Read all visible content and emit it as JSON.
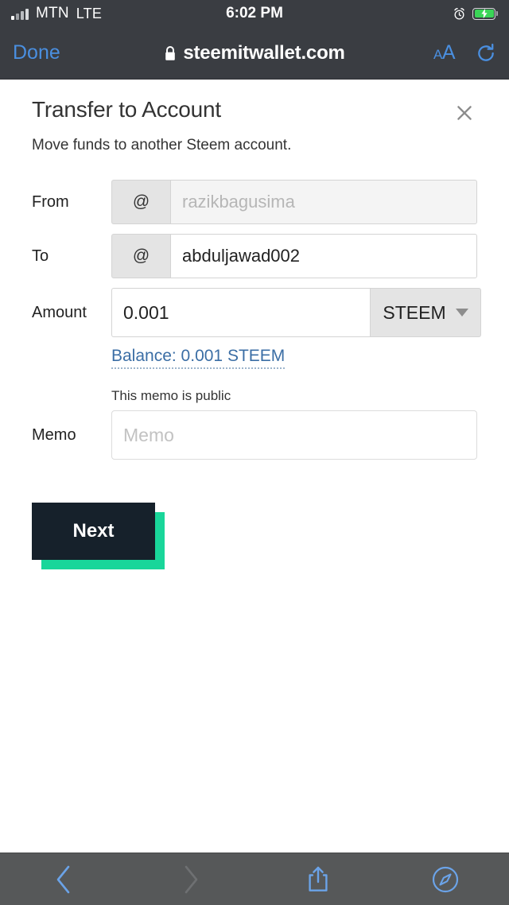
{
  "status_bar": {
    "carrier": "MTN",
    "network": "LTE",
    "time": "6:02 PM",
    "alarm_icon": "alarm-clock-icon",
    "battery_icon": "battery-charging-icon",
    "signal_icon": "signal-bars-icon"
  },
  "browser": {
    "done_label": "Done",
    "lock_icon": "lock-icon",
    "url": "steemitwallet.com",
    "text_size_small": "A",
    "text_size_large": "A",
    "reload_icon": "reload-icon",
    "toolbar": {
      "back_icon": "chevron-left-icon",
      "forward_icon": "chevron-right-icon",
      "share_icon": "share-icon",
      "tabs_icon": "compass-icon"
    }
  },
  "page": {
    "title": "Transfer to Account",
    "subtitle": "Move funds to another Steem account.",
    "close_icon": "close-icon"
  },
  "form": {
    "from": {
      "label": "From",
      "addon": "@",
      "value": "",
      "placeholder": "razikbagusima",
      "disabled": true
    },
    "to": {
      "label": "To",
      "addon": "@",
      "value": "abduljawad002",
      "placeholder": ""
    },
    "amount": {
      "label": "Amount",
      "value": "0.001",
      "placeholder": "",
      "asset": "STEEM",
      "caret_icon": "caret-down-icon"
    },
    "balance": {
      "text": "Balance: 0.001 STEEM"
    },
    "memo": {
      "label": "Memo",
      "note": "This memo is public",
      "value": "",
      "placeholder": "Memo"
    },
    "submit": {
      "label": "Next"
    }
  },
  "colors": {
    "accent_teal": "#19d69a",
    "button_dark": "#16212b",
    "ios_blue": "#4a8fe0",
    "link_blue": "#3b6ea5",
    "chrome_dark": "#3a3d42",
    "toolbar_gray": "#565859",
    "battery_green": "#3ad557"
  }
}
